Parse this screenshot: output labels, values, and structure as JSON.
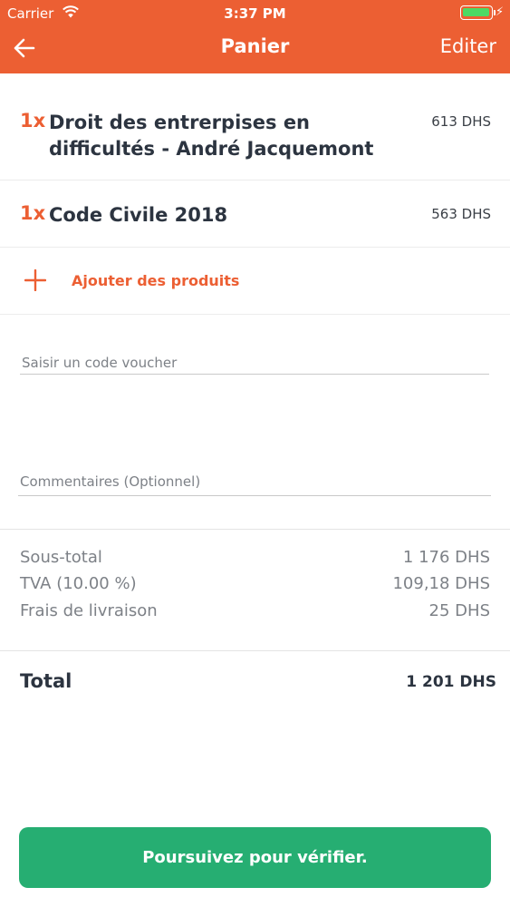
{
  "status_bar": {
    "carrier": "Carrier",
    "time": "3:37 PM",
    "battery_level": 1.0,
    "wifi_icon": "wifi-icon",
    "charging_icon": "bolt-icon"
  },
  "nav": {
    "back_icon": "arrow-left-icon",
    "title": "Panier",
    "edit_label": "Editer"
  },
  "cart": {
    "items": [
      {
        "qty": "1x",
        "name": "Droit des entrerpises en difficultés - André Jacquemont",
        "price": "613 DHS"
      },
      {
        "qty": "1x",
        "name": "Code Civile 2018",
        "price": "563 DHS"
      }
    ],
    "add_icon": "plus-icon",
    "add_label": "Ajouter des produits"
  },
  "form": {
    "voucher_placeholder": "Saisir un code voucher",
    "comment_placeholder": "Commentaires (Optionnel)"
  },
  "summary": {
    "subtotal_label": "Sous-total",
    "subtotal_value": "1 176 DHS",
    "tva_label": "TVA (10.00 %)",
    "tva_value": "109,18 DHS",
    "delivery_label": "Frais de livraison",
    "delivery_value": "25 DHS",
    "total_label": "Total",
    "total_value": "1 201 DHS"
  },
  "cta": {
    "label": "Poursuivez pour vérifier."
  },
  "colors": {
    "accent": "#ec5f33",
    "cta": "#26ae72",
    "text": "#2c3440",
    "muted": "#7d8187"
  }
}
